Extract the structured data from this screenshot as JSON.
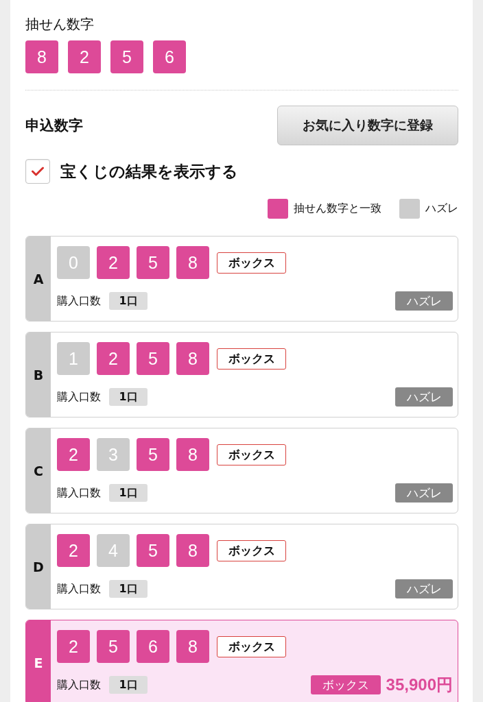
{
  "draw": {
    "title": "抽せん数字",
    "numbers": [
      "8",
      "2",
      "5",
      "6"
    ]
  },
  "entry": {
    "title": "申込数字",
    "favorite_button": "お気に入り数字に登録",
    "show_result": {
      "label": "宝くじの結果を表示する",
      "checked": true
    }
  },
  "legend": [
    {
      "label": "抽せん数字と一致",
      "color": "#dd4a98"
    },
    {
      "label": "ハズレ",
      "color": "#cccccc"
    }
  ],
  "tickets": [
    {
      "letter": "A",
      "numbers": [
        {
          "value": "0",
          "matched": false
        },
        {
          "value": "2",
          "matched": true
        },
        {
          "value": "5",
          "matched": true
        },
        {
          "value": "8",
          "matched": true
        }
      ],
      "type": "ボックス",
      "quantity_label": "購入口数",
      "quantity": "1口",
      "result": {
        "kind": "miss",
        "label": "ハズレ"
      }
    },
    {
      "letter": "B",
      "numbers": [
        {
          "value": "1",
          "matched": false
        },
        {
          "value": "2",
          "matched": true
        },
        {
          "value": "5",
          "matched": true
        },
        {
          "value": "8",
          "matched": true
        }
      ],
      "type": "ボックス",
      "quantity_label": "購入口数",
      "quantity": "1口",
      "result": {
        "kind": "miss",
        "label": "ハズレ"
      }
    },
    {
      "letter": "C",
      "numbers": [
        {
          "value": "2",
          "matched": true
        },
        {
          "value": "3",
          "matched": false
        },
        {
          "value": "5",
          "matched": true
        },
        {
          "value": "8",
          "matched": true
        }
      ],
      "type": "ボックス",
      "quantity_label": "購入口数",
      "quantity": "1口",
      "result": {
        "kind": "miss",
        "label": "ハズレ"
      }
    },
    {
      "letter": "D",
      "numbers": [
        {
          "value": "2",
          "matched": true
        },
        {
          "value": "4",
          "matched": false
        },
        {
          "value": "5",
          "matched": true
        },
        {
          "value": "8",
          "matched": true
        }
      ],
      "type": "ボックス",
      "quantity_label": "購入口数",
      "quantity": "1口",
      "result": {
        "kind": "miss",
        "label": "ハズレ"
      }
    },
    {
      "letter": "E",
      "numbers": [
        {
          "value": "2",
          "matched": true
        },
        {
          "value": "5",
          "matched": true
        },
        {
          "value": "6",
          "matched": true
        },
        {
          "value": "8",
          "matched": true
        }
      ],
      "type": "ボックス",
      "quantity_label": "購入口数",
      "quantity": "1口",
      "result": {
        "kind": "win",
        "label": "ボックス",
        "amount": "35,900円"
      }
    }
  ]
}
